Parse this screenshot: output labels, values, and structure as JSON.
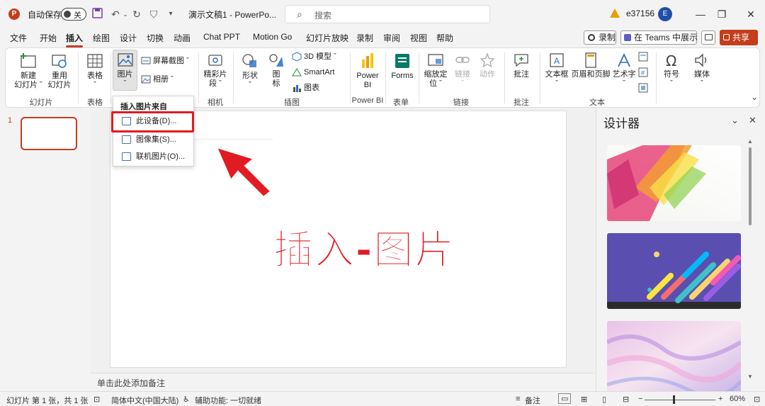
{
  "titlebar": {
    "app_icon": "P",
    "autosave_label": "自动保存",
    "toggle_state": "关",
    "doc_title": "演示文稿1  -  PowerPo...",
    "search_placeholder": "搜索",
    "user_name": "e37156",
    "avatar_letter": "E",
    "minimize": "—",
    "restore": "❐",
    "close": "✕"
  },
  "menu": {
    "tabs": [
      "文件",
      "开始",
      "插入",
      "绘图",
      "设计",
      "切换",
      "动画",
      "Chat PPT",
      "Motion Go",
      "幻灯片放映",
      "录制",
      "审阅",
      "视图",
      "帮助"
    ],
    "active_tab": "插入",
    "record": "录制",
    "teams": "在 Teams 中展示",
    "share": "共享"
  },
  "ribbon": {
    "new_slide": [
      "新建",
      "幻灯片 ˇ"
    ],
    "reuse_slide": [
      "重用",
      "幻灯片"
    ],
    "group_slides": "幻灯片",
    "table": "表格",
    "group_table": "表格",
    "pictures": "图片",
    "screenshot": "屏幕截图",
    "album": "相册",
    "group_images_hidden": "",
    "highlight_clip": [
      "精彩片",
      "段 ˇ"
    ],
    "group_camera": "相机",
    "shapes": "形状",
    "icons": [
      "图",
      "标"
    ],
    "model3d": "3D 模型",
    "smartart": "SmartArt",
    "chart": "图表",
    "group_illustrations": "插图",
    "powerbi": [
      "Power",
      "BI"
    ],
    "group_powerbi": "Power BI",
    "forms": "Forms",
    "group_forms": "表单",
    "zoom": [
      "缩放定",
      "位 ˇ"
    ],
    "link": "链接",
    "action": "动作",
    "group_links": "链接",
    "comment": "批注",
    "group_comments": "批注",
    "textbox": "文本框",
    "header_footer": "页眉和页脚",
    "wordart": "艺术字",
    "group_text": "文本",
    "symbol": "符号",
    "media": "媒体"
  },
  "dropdown": {
    "header": "插入图片来自",
    "items": [
      "此设备(D)...",
      "图像集(S)...",
      "联机图片(O)..."
    ]
  },
  "slides_pane": {
    "number": "1"
  },
  "slide": {
    "overlay_text": "插入-图片"
  },
  "notes": {
    "placeholder": "单击此处添加备注"
  },
  "designer": {
    "title": "设计器"
  },
  "status": {
    "slide_info": "幻灯片 第 1 张，共 1 张",
    "language": "简体中文(中国大陆)",
    "accessibility": "辅助功能: 一切就绪",
    "notes_btn": "备注",
    "zoom_level": "60%",
    "zoom_value_percent": 60
  },
  "colors": {
    "accent": "#c43e1c",
    "highlight_red": "#e11b22"
  }
}
